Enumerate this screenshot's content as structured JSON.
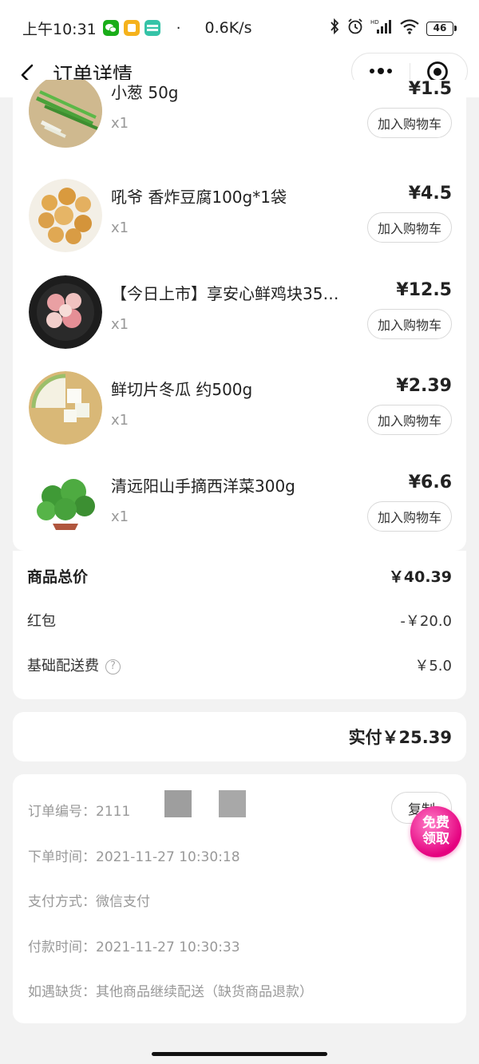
{
  "status_bar": {
    "time": "上午10:31",
    "dot": "·",
    "net_speed": "0.6K/s",
    "battery": "46",
    "icons": [
      "wechat-icon",
      "notes-app-icon",
      "boss-app-icon",
      "bluetooth-icon",
      "alarm-icon",
      "hd-signal-icon",
      "wifi-icon",
      "battery-icon"
    ]
  },
  "nav": {
    "title": "订单详情",
    "icons": [
      "back-arrow-icon",
      "more-dots-icon",
      "target-close-icon"
    ]
  },
  "items": [
    {
      "name": "小葱 50g",
      "qty": "x1",
      "price": "¥1.5",
      "cart_label": "加入购物车",
      "image": "scallion"
    },
    {
      "name": "吼爷 香炸豆腐100g*1袋",
      "qty": "x1",
      "price": "¥4.5",
      "cart_label": "加入购物车",
      "image": "fried-tofu"
    },
    {
      "name": "【今日上市】享安心鲜鸡块35…",
      "qty": "x1",
      "price": "¥12.5",
      "cart_label": "加入购物车",
      "image": "chicken"
    },
    {
      "name": "鲜切片冬瓜 约500g",
      "qty": "x1",
      "price": "¥2.39",
      "cart_label": "加入购物车",
      "image": "winter-melon"
    },
    {
      "name": "清远阳山手摘西洋菜300g",
      "qty": "x1",
      "price": "¥6.6",
      "cart_label": "加入购物车",
      "image": "watercress"
    }
  ],
  "summary": {
    "total_label": "商品总价",
    "total_value": "￥40.39",
    "redpacket_label": "红包",
    "redpacket_value": "-￥20.0",
    "delivery_label": "基础配送费",
    "delivery_help": "?",
    "delivery_value": "￥5.0"
  },
  "payment": {
    "paid_text": "实付￥25.39"
  },
  "order_info": {
    "order_no_label": "订单编号：",
    "order_no_value": "2111",
    "copy_label": "复制",
    "order_time_label": "下单时间：",
    "order_time_value": "2021-11-27 10:30:18",
    "pay_method_label": "支付方式：",
    "pay_method_value": "微信支付",
    "pay_time_label": "付款时间：",
    "pay_time_value": "2021-11-27 10:30:33",
    "shortage_label": "如遇缺货：",
    "shortage_value": "其他商品继续配送（缺货商品退款）"
  },
  "promo": {
    "line1": "免费",
    "line2": "领取"
  },
  "colors": {
    "page_bg": "#f2f2f2",
    "card_bg": "#ffffff",
    "promo_pink": "#e5007f",
    "muted_text": "#999999"
  }
}
